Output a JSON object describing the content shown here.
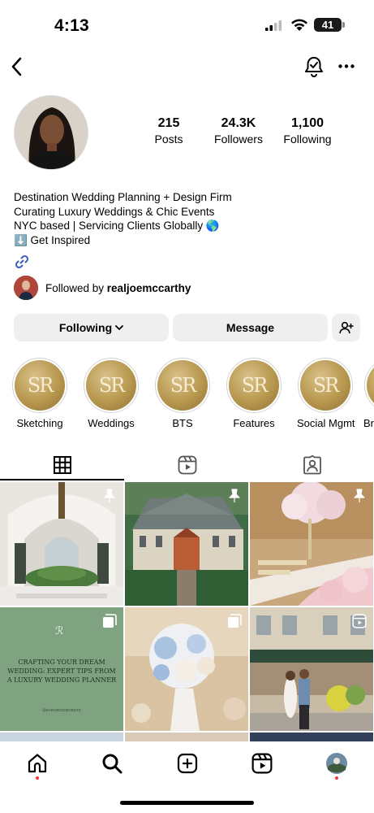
{
  "status_bar": {
    "time": "4:13",
    "battery": "41"
  },
  "profile": {
    "stats": [
      {
        "value": "215",
        "label": "Posts"
      },
      {
        "value": "24.3K",
        "label": "Followers"
      },
      {
        "value": "1,100",
        "label": "Following"
      }
    ],
    "bio": [
      "Destination Wedding Planning + Design Firm",
      "Curating Luxury Weddings & Chic Events",
      "NYC based | Servicing Clients Globally 🌎",
      "⬇️ Get Inspired"
    ],
    "followed_by_prefix": "Followed by ",
    "followed_by_user": "realjoemccarthy"
  },
  "actions": {
    "following": "Following",
    "message": "Message"
  },
  "highlights": [
    {
      "label": "Sketching",
      "monogram": "SR"
    },
    {
      "label": "Weddings",
      "monogram": "SR"
    },
    {
      "label": "BTS",
      "monogram": "SR"
    },
    {
      "label": "Features",
      "monogram": "SR"
    },
    {
      "label": "Social Mgmt",
      "monogram": "SR"
    },
    {
      "label": "Br",
      "monogram": "SR"
    }
  ],
  "grid": {
    "post4_text": "CRAFTING YOUR DREAM WEDDING: EXPERT TIPS FROM A LUXURY WEDDING PLANNER",
    "post4_handle": "@SARAROSSEVENTS"
  },
  "icons": {
    "back": "chevron-left-icon",
    "bell": "notification-bell-icon",
    "more": "more-horizontal-icon",
    "link": "link-icon",
    "add_user": "add-user-icon",
    "pin": "pin-icon",
    "grid_tab": "grid-icon",
    "reels_tab": "reels-icon",
    "tagged_tab": "tagged-icon",
    "home": "home-icon",
    "search": "search-icon",
    "create": "create-icon",
    "reels": "reels-icon"
  },
  "colors": {
    "button_bg": "#efefef",
    "highlight_gold": "#b8974e",
    "notification_dot": "#ff3040",
    "post4_bg": "#7fa281"
  }
}
